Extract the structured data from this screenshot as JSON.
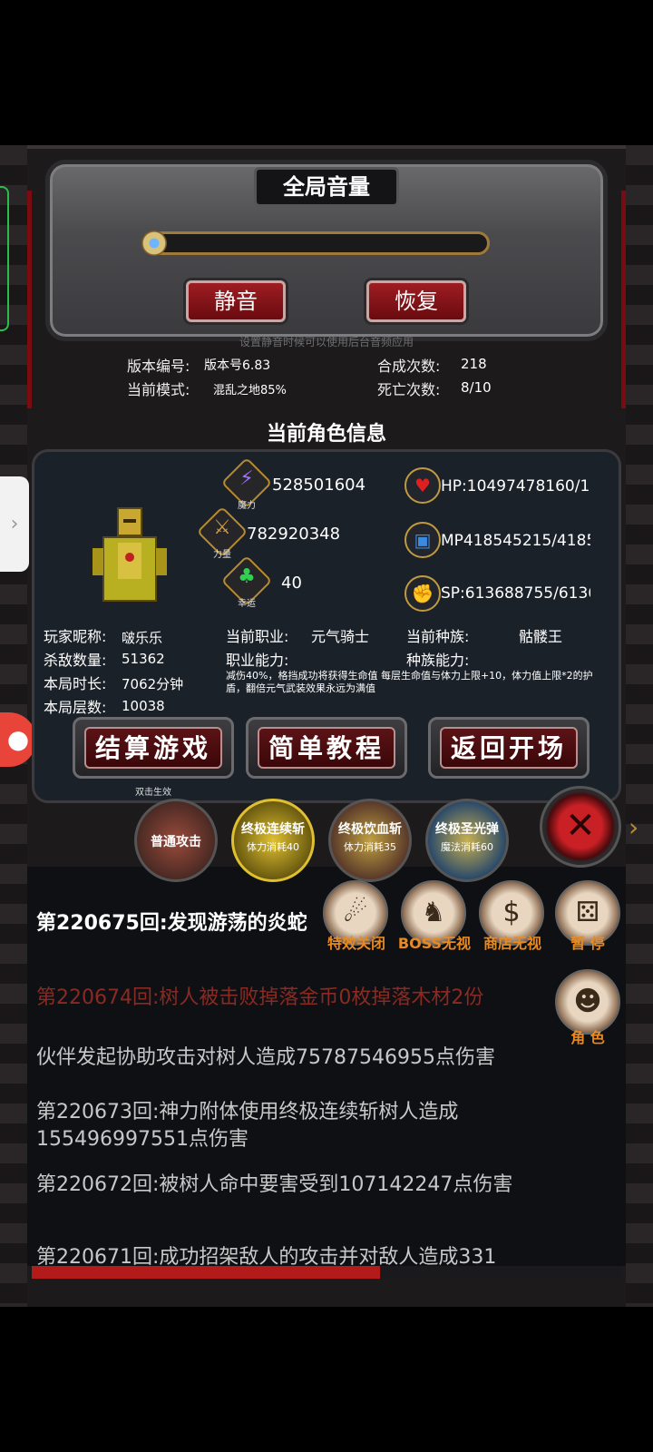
{
  "settings": {
    "title": "全局音量",
    "volume_level": 0,
    "mute_label": "静音",
    "restore_label": "恢复",
    "mute_hint": "设置静音时候可以使用后台音频应用"
  },
  "game_info": {
    "version_label": "版本编号:",
    "version_value": "版本号6.83",
    "mode_label": "当前模式:",
    "mode_value": "混乱之地85%",
    "craft_label": "合成次数:",
    "craft_value": "218",
    "death_label": "死亡次数:",
    "death_value": "8/10"
  },
  "character": {
    "section_title": "当前角色信息",
    "stats": {
      "magic": {
        "caption": "魔力",
        "value": "528501604",
        "icon": "lightning-icon"
      },
      "strength": {
        "caption": "力量",
        "value": "782920348",
        "icon": "sword-icon"
      },
      "luck": {
        "caption": "幸运",
        "value": "40",
        "icon": "clover-icon"
      }
    },
    "resources": {
      "hp": {
        "label": "HP",
        "value": ":10497478160/1",
        "icon": "heart-icon"
      },
      "mp": {
        "label": "MP",
        "value": "418545215/4185",
        "icon": "mana-icon"
      },
      "sp": {
        "label": "SP",
        "value": ":613688755/61368",
        "icon": "muscle-icon"
      }
    },
    "nickname_label": "玩家昵称:",
    "nickname": "啵乐乐",
    "kills_label": "杀敌数量:",
    "kills": "51362",
    "duration_label": "本局时长:",
    "duration": "7062分钟",
    "floor_label": "本局层数:",
    "floor": "10038",
    "job_label": "当前职业:",
    "job": "元气骑士",
    "job_ability_label": "职业能力:",
    "job_ability": "减伤40%，格挡成功将获得生命值 每层生命值与体力上限+10，体力值上限*2的护盾，翻倍元气武装效果永远为满值",
    "race_label": "当前种族:",
    "race": "骷髅王",
    "race_ability_label": "种族能力:"
  },
  "actions": {
    "settle_label": "结算游戏",
    "settle_hint": "双击生效",
    "tutorial_label": "简单教程",
    "return_label": "返回开场"
  },
  "skills": [
    {
      "name": "普通攻击",
      "cost": ""
    },
    {
      "name": "终极连续斩",
      "cost": "体力消耗40"
    },
    {
      "name": "终极饮血斩",
      "cost": "体力消耗35"
    },
    {
      "name": "终极圣光弹",
      "cost": "魔法消耗60"
    }
  ],
  "side_actions": {
    "effects_label": "特效关闭",
    "boss_label": "BOSS无视",
    "shop_label": "商店无视",
    "pause_label": "暂 停",
    "role_label": "角 色"
  },
  "log": [
    {
      "text": "第220675回:发现游荡的炎蛇",
      "color": "#ffffff"
    },
    {
      "text": "第220674回:树人被击败掉落金币0枚掉落木材2份",
      "color": "#8a2a22"
    },
    {
      "text": "伙伴发起协助攻击对树人造成75787546955点伤害",
      "color": "#c8c8c8"
    },
    {
      "text": "第220673回:神力附体使用终极连续斩树人造成155496997551点伤害",
      "color": "#c8c8c8"
    },
    {
      "text": "第220672回:被树人命中要害受到107142247点伤害",
      "color": "#c8c8c8"
    },
    {
      "text": "第220671回:成功招架敌人的攻击并对敌人造成331",
      "color": "#c8c8c8"
    }
  ],
  "progress_fraction": 0.59
}
